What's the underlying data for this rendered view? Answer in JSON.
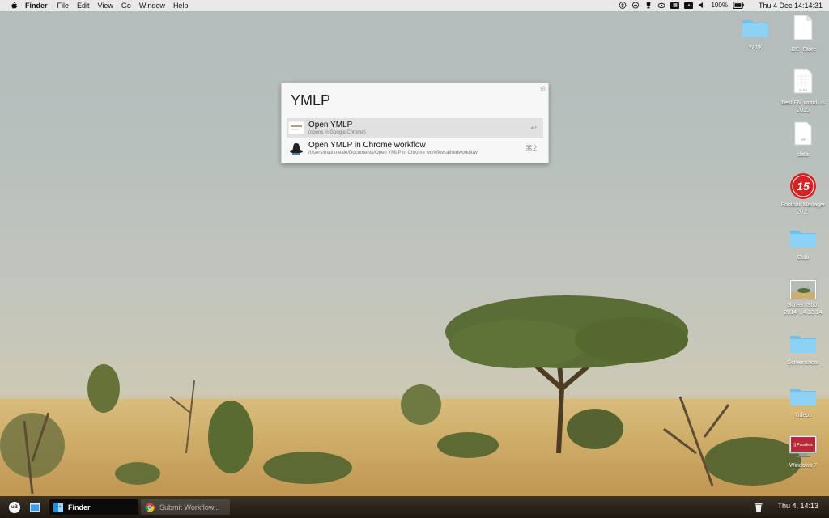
{
  "menubar": {
    "apple_icon": "apple-icon",
    "app_name": "Finder",
    "items": [
      "File",
      "Edit",
      "View",
      "Go",
      "Window",
      "Help"
    ],
    "status": {
      "battery": "100%",
      "clock": "Thu 4 Dec  14:14:31"
    }
  },
  "alfred": {
    "query": "YMLP",
    "results": [
      {
        "title": "Open YMLP",
        "subtitle": "(opens in Google Chrome)",
        "shortcut": "↩",
        "icon": "ymlp-logo-icon"
      },
      {
        "title": "Open YMLP in Chrome workflow",
        "subtitle": "/Users/mattkneale/Documents/Open YMLP in Chrome workflow.alfredworkflow",
        "shortcut": "⌘2",
        "icon": "alfred-hat-icon"
      }
    ]
  },
  "desktop": {
    "icons": [
      {
        "label": "Work",
        "kind": "folder-icon"
      },
      {
        "label": ".DS_Store",
        "kind": "document-icon"
      },
      {
        "label": "best FM wond...s 2015",
        "kind": "xlsx-document-icon",
        "badge": "XLSX"
      },
      {
        "label": "data",
        "kind": "csv-document-icon",
        "badge": "csv"
      },
      {
        "label": "Football Manager 2015",
        "kind": "fm15-app-icon",
        "badge": "15"
      },
      {
        "label": "Gulu",
        "kind": "folder-icon"
      },
      {
        "label": "Screen Shot 2014-...4.13.14",
        "kind": "screenshot-icon"
      },
      {
        "label": "Screenshots",
        "kind": "folder-icon"
      },
      {
        "label": "Videos",
        "kind": "folder-icon"
      },
      {
        "label": "Windows 7",
        "kind": "parallels-vm-icon",
        "badge": "|| Parallels"
      }
    ]
  },
  "taskbar": {
    "start_label": "uB",
    "tasks": [
      {
        "label": "Finder",
        "active": true
      },
      {
        "label": "Submit Workflow...",
        "active": false
      }
    ],
    "clock": "Thu 4, 14:13"
  }
}
